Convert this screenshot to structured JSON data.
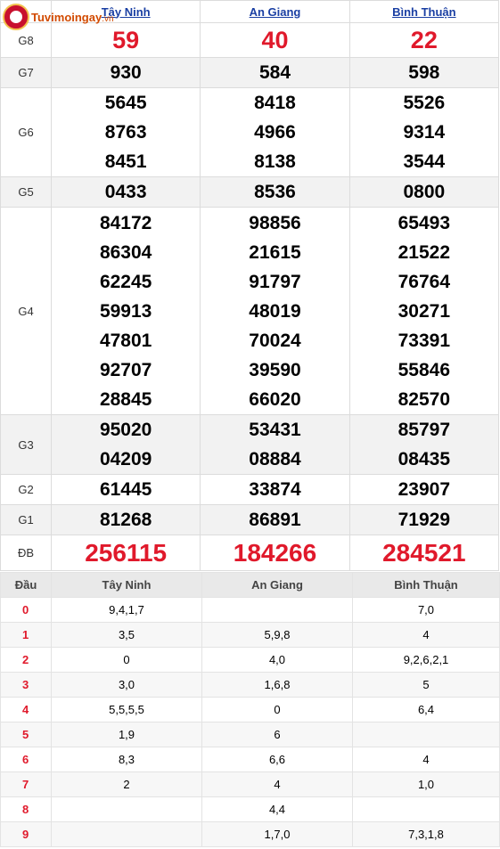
{
  "logo": {
    "text": "Tuvimoingay",
    "suffix": ".vn"
  },
  "provinces": [
    "Tây Ninh",
    "An Giang",
    "Bình Thuận"
  ],
  "prizes": [
    {
      "label": "G8",
      "values": [
        [
          "59"
        ],
        [
          "40"
        ],
        [
          "22"
        ]
      ]
    },
    {
      "label": "G7",
      "values": [
        [
          "930"
        ],
        [
          "584"
        ],
        [
          "598"
        ]
      ]
    },
    {
      "label": "G6",
      "values": [
        [
          "5645",
          "8763",
          "8451"
        ],
        [
          "8418",
          "4966",
          "8138"
        ],
        [
          "5526",
          "9314",
          "3544"
        ]
      ]
    },
    {
      "label": "G5",
      "values": [
        [
          "0433"
        ],
        [
          "8536"
        ],
        [
          "0800"
        ]
      ]
    },
    {
      "label": "G4",
      "values": [
        [
          "84172",
          "86304",
          "62245",
          "59913",
          "47801",
          "92707",
          "28845"
        ],
        [
          "98856",
          "21615",
          "91797",
          "48019",
          "70024",
          "39590",
          "66020"
        ],
        [
          "65493",
          "21522",
          "76764",
          "30271",
          "73391",
          "55846",
          "82570"
        ]
      ]
    },
    {
      "label": "G3",
      "values": [
        [
          "95020",
          "04209"
        ],
        [
          "53431",
          "08884"
        ],
        [
          "85797",
          "08435"
        ]
      ]
    },
    {
      "label": "G2",
      "values": [
        [
          "61445"
        ],
        [
          "33874"
        ],
        [
          "23907"
        ]
      ]
    },
    {
      "label": "G1",
      "values": [
        [
          "81268"
        ],
        [
          "86891"
        ],
        [
          "71929"
        ]
      ]
    },
    {
      "label": "ĐB",
      "values": [
        [
          "256115"
        ],
        [
          "184266"
        ],
        [
          "284521"
        ]
      ]
    }
  ],
  "dau_table": {
    "header": [
      "Đầu",
      "Tây Ninh",
      "An Giang",
      "Bình Thuận"
    ],
    "rows": [
      [
        "0",
        "9,4,1,7",
        "",
        "7,0"
      ],
      [
        "1",
        "3,5",
        "5,9,8",
        "4"
      ],
      [
        "2",
        "0",
        "4,0",
        "9,2,6,2,1"
      ],
      [
        "3",
        "3,0",
        "1,6,8",
        "5"
      ],
      [
        "4",
        "5,5,5,5",
        "0",
        "6,4"
      ],
      [
        "5",
        "1,9",
        "6",
        ""
      ],
      [
        "6",
        "8,3",
        "6,6",
        "4"
      ],
      [
        "7",
        "2",
        "4",
        "1,0"
      ],
      [
        "8",
        "",
        "4,4",
        ""
      ],
      [
        "9",
        "",
        "1,7,0",
        "7,3,1,8"
      ]
    ]
  }
}
